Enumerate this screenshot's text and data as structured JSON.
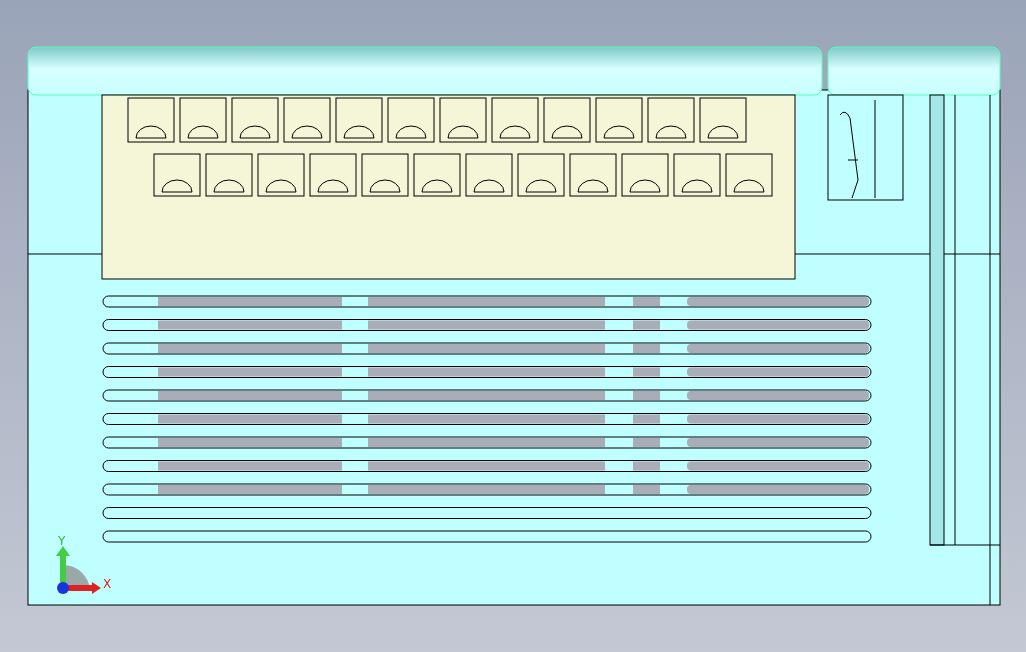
{
  "viewport": {
    "axis_triad": {
      "y_label": "Y",
      "x_label": "X"
    }
  }
}
